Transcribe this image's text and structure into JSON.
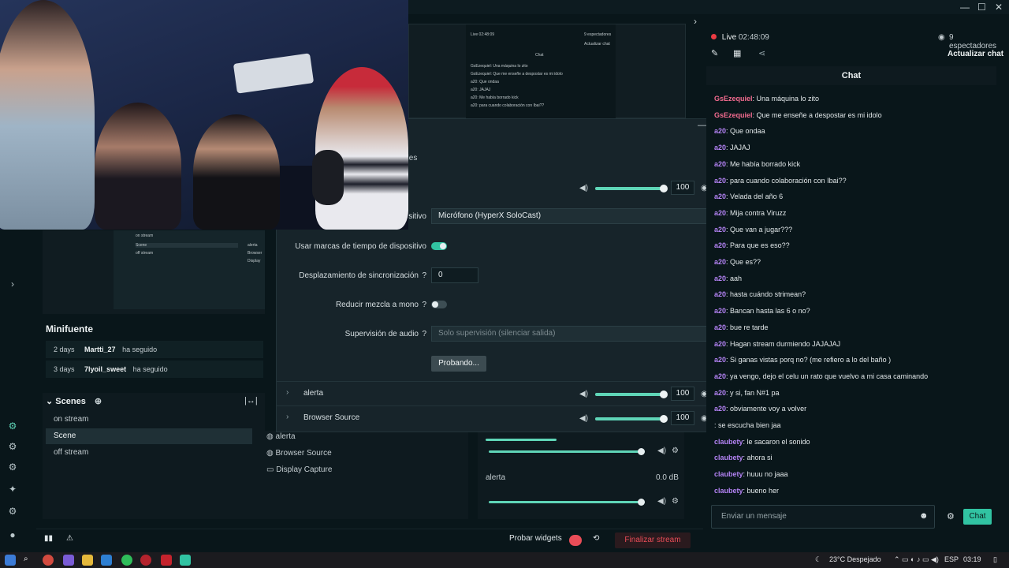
{
  "window": {
    "controls": {
      "minimize": "—",
      "maximize": "☐",
      "close": "✕"
    }
  },
  "stream": {
    "live_label": "Live",
    "duration": "02:48:09",
    "viewers": "9 espectadores",
    "refresh_chat": "Actualizar chat"
  },
  "nested_preview": {
    "live_label": "Live 02:48:09",
    "viewers": "9 espectadores",
    "refresh": "Actualizar chat",
    "chat_title": "Chat",
    "lines": [
      "GsEzequiel: Una máquina lo zito",
      "GsEzequiel: Que me enseñe a despostar es mi idolo",
      "a20: Que ondaa",
      "a20: JAJAJ",
      "a20: Me había borrado kick",
      "a20: para cuando colaboración con Ibai??"
    ]
  },
  "editor_preview": {
    "scenes": [
      "on stream",
      "Scene",
      "off stream"
    ],
    "sources": [
      "alerta",
      "Browser",
      "Display"
    ]
  },
  "minifuente": {
    "title": "Minifuente",
    "rows": [
      {
        "time": "2 days",
        "user": "Martti_27",
        "action": "ha seguido"
      },
      {
        "time": "3 days",
        "user": "7lyoil_sweet",
        "action": "ha seguido"
      }
    ]
  },
  "scenes": {
    "title": "Scenes",
    "items": [
      "on stream",
      "Scene",
      "off stream"
    ]
  },
  "sources": {
    "items": [
      "alerta",
      "Browser Source",
      "Display Capture"
    ]
  },
  "mixer": {
    "alerta_label": "alerta",
    "alerta_db": "0.0 dB"
  },
  "footer": {
    "test_widgets": "Probar widgets",
    "end_stream": "Finalizar stream"
  },
  "dialog": {
    "tab_partial": "ales",
    "top_volume": "100",
    "device_label_partial": "sitivo",
    "device_value": "Micrófono (HyperX SoloCast)",
    "timestamps_label": "Usar marcas de tiempo de dispositivo",
    "sync_label": "Desplazamiento de sincronización",
    "sync_value": "0",
    "mono_label": "Reducir mezcla a mono",
    "monitor_label": "Supervisión de audio",
    "monitor_value": "Solo supervisión (silenciar salida)",
    "test_button": "Probando...",
    "source_rows": [
      {
        "name": "alerta",
        "volume": "100"
      },
      {
        "name": "Browser Source",
        "volume": "100"
      }
    ]
  },
  "chat": {
    "title": "Chat",
    "input_placeholder": "Enviar un mensaje",
    "send_label": "Chat",
    "messages": [
      {
        "user": "GsEzequiel",
        "text": ": Una máquina lo zito",
        "color": "#f26b8f"
      },
      {
        "user": "GsEzequiel",
        "text": ": Que me enseñe a despostar es mi idolo",
        "color": "#f26b8f"
      },
      {
        "user": "a20",
        "text": ": Que ondaa",
        "color": "#b483f5"
      },
      {
        "user": "a20",
        "text": ": JAJAJ",
        "color": "#b483f5"
      },
      {
        "user": "a20",
        "text": ": Me había borrado kick",
        "color": "#b483f5"
      },
      {
        "user": "a20",
        "text": ": para cuando colaboración con Ibai??",
        "color": "#b483f5"
      },
      {
        "user": "a20",
        "text": ": Velada del año 6",
        "color": "#b483f5"
      },
      {
        "user": "a20",
        "text": ": Mija contra Viruzz",
        "color": "#b483f5"
      },
      {
        "user": "a20",
        "text": ": Que van a jugar???",
        "color": "#b483f5"
      },
      {
        "user": "a20",
        "text": ": Para que es eso??",
        "color": "#b483f5"
      },
      {
        "user": "a20",
        "text": ": Que es??",
        "color": "#b483f5"
      },
      {
        "user": "a20",
        "text": ": aah",
        "color": "#b483f5"
      },
      {
        "user": "a20",
        "text": ": hasta cuándo strimean?",
        "color": "#b483f5"
      },
      {
        "user": "a20",
        "text": ": Bancan hasta las 6 o no?",
        "color": "#b483f5"
      },
      {
        "user": "a20",
        "text": ": bue re tarde",
        "color": "#b483f5"
      },
      {
        "user": "a20",
        "text": ": Hagan stream durmiendo JAJAJAJ",
        "color": "#b483f5"
      },
      {
        "user": "a20",
        "text": ": Si ganas vistas porq no? (me refiero a lo del baño )",
        "color": "#b483f5"
      },
      {
        "user": "a20",
        "text": ": ya vengo, dejo el celu un rato que vuelvo a mi casa caminando",
        "color": "#b483f5"
      },
      {
        "user": "a20",
        "text": ": y si, fan N#1 pa",
        "color": "#b483f5"
      },
      {
        "user": "a20",
        "text": ": obviamente voy a volver",
        "color": "#b483f5"
      },
      {
        "user": "",
        "text": ": se escucha bien jaa",
        "color": "#b483f5"
      },
      {
        "user": "claubety",
        "text": ": le sacaron el sonido",
        "color": "#b483f5"
      },
      {
        "user": "claubety",
        "text": ": ahora si",
        "color": "#b483f5"
      },
      {
        "user": "claubety",
        "text": ": huuu no jaaa",
        "color": "#b483f5"
      },
      {
        "user": "claubety",
        "text": ": bueno her",
        "color": "#b483f5"
      }
    ]
  },
  "taskbar": {
    "weather": "23°C  Despejado",
    "lang": "ESP",
    "time": "03:19"
  },
  "colors": {
    "accent": "#31c3a2",
    "danger": "#ea4d58",
    "bg": "#09161a"
  }
}
